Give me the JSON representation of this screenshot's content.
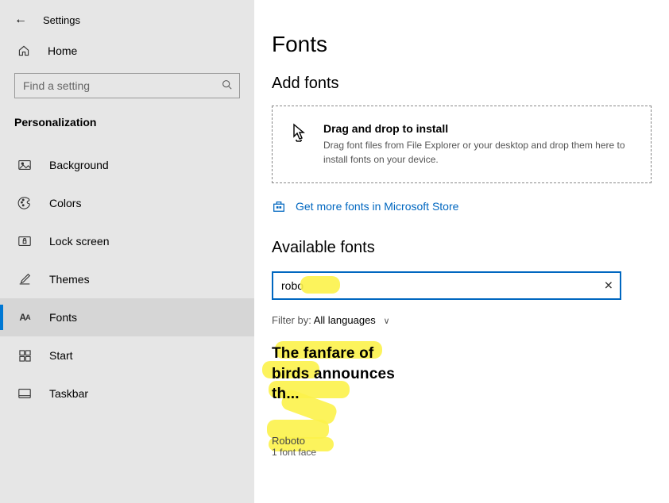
{
  "header": {
    "settings_label": "Settings"
  },
  "sidebar": {
    "home_label": "Home",
    "search_placeholder": "Find a setting",
    "section_title": "Personalization",
    "items": [
      {
        "label": "Background"
      },
      {
        "label": "Colors"
      },
      {
        "label": "Lock screen"
      },
      {
        "label": "Themes"
      },
      {
        "label": "Fonts"
      },
      {
        "label": "Start"
      },
      {
        "label": "Taskbar"
      }
    ]
  },
  "page": {
    "title": "Fonts",
    "add_fonts_heading": "Add fonts",
    "drop_title": "Drag and drop to install",
    "drop_desc": "Drag font files from File Explorer or your desktop and drop them here to install fonts on your device.",
    "store_link_text": "Get more fonts in Microsoft Store",
    "available_heading": "Available fonts",
    "font_search_value": "robo",
    "filter_label": "Filter by:",
    "filter_value": "All languages",
    "font_card": {
      "preview": "The fanfare of birds announces th...",
      "name": "Roboto",
      "faces": "1 font face"
    }
  }
}
